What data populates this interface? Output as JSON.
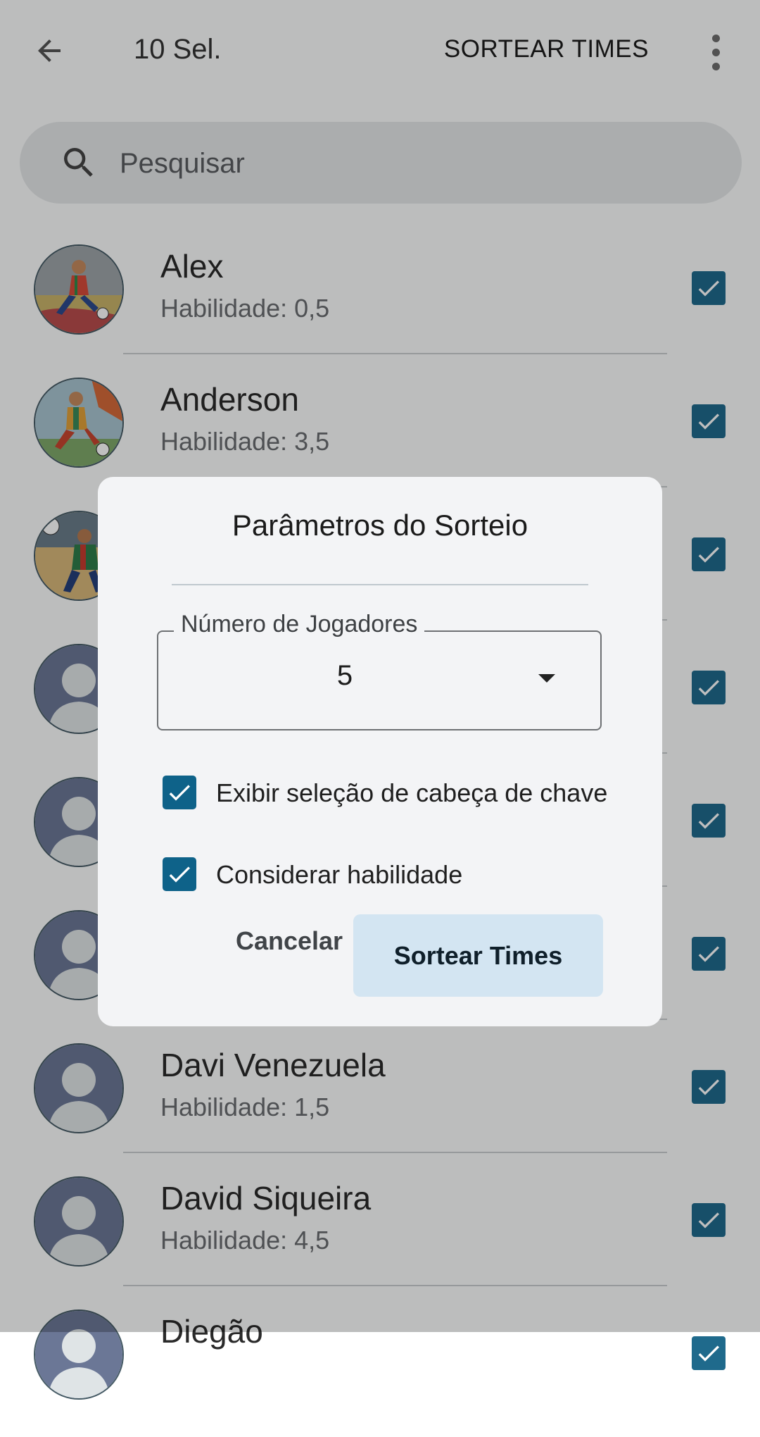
{
  "topbar": {
    "title": "10 Sel.",
    "action_label": "SORTEAR TIMES",
    "back_icon": "arrow-left-icon",
    "more_icon": "more-vert-icon"
  },
  "search": {
    "placeholder": "Pesquisar",
    "value": ""
  },
  "players": [
    {
      "name": "Alex",
      "skill": "Habilidade: 0,5",
      "avatar": "photo-1",
      "checked": true
    },
    {
      "name": "Anderson",
      "skill": "Habilidade: 3,5",
      "avatar": "photo-2",
      "checked": true
    },
    {
      "name": "",
      "skill": "",
      "avatar": "photo-3",
      "checked": true
    },
    {
      "name": "",
      "skill": "",
      "avatar": "default",
      "checked": true
    },
    {
      "name": "",
      "skill": "",
      "avatar": "default",
      "checked": true
    },
    {
      "name": "",
      "skill": "",
      "avatar": "default",
      "checked": true
    },
    {
      "name": "Davi Venezuela",
      "skill": "Habilidade: 1,5",
      "avatar": "default",
      "checked": true
    },
    {
      "name": "David Siqueira",
      "skill": "Habilidade: 4,5",
      "avatar": "default",
      "checked": true
    },
    {
      "name": "Diegão",
      "skill": "",
      "avatar": "default",
      "checked": true
    }
  ],
  "dialog": {
    "title": "Parâmetros do Sorteio",
    "field_label": "Número de Jogadores",
    "field_value": "5",
    "option_seed": "Exibir seleção de cabeça de chave",
    "option_skill": "Considerar habilidade",
    "cancel_label": "Cancelar",
    "confirm_label": "Sortear Times"
  },
  "colors": {
    "checkbox": "#1f6a8c",
    "primary_button_bg": "#d3e5f2",
    "scrim": "rgba(0,0,0,0.25)"
  }
}
